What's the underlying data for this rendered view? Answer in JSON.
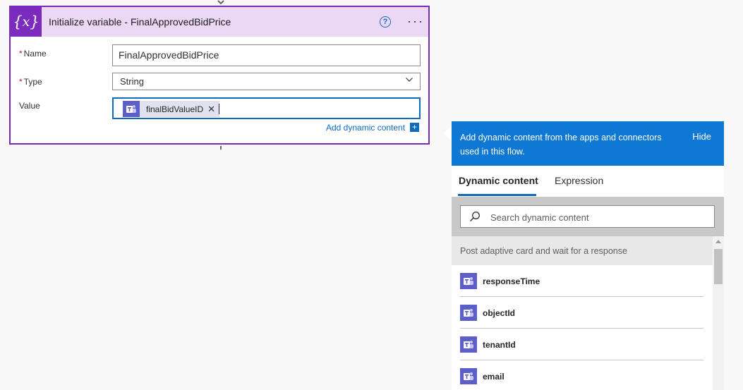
{
  "card": {
    "title": "Initialize variable - FinalApprovedBidPrice",
    "icon": "variable-icon",
    "fields": {
      "name_label": "Name",
      "name_value": "FinalApprovedBidPrice",
      "type_label": "Type",
      "type_value": "String",
      "value_label": "Value",
      "value_token": "finalBidValueID",
      "required_mark": "*"
    },
    "add_dynamic_label": "Add dynamic content",
    "plus": "+",
    "help_glyph": "?",
    "more_glyph": "···"
  },
  "panel": {
    "header_text": "Add dynamic content from the apps and connectors used in this flow.",
    "hide_label": "Hide",
    "tabs": [
      {
        "label": "Dynamic content",
        "active": true
      },
      {
        "label": "Expression",
        "active": false
      }
    ],
    "search": {
      "placeholder": "Search dynamic content"
    },
    "section_title": "Post adaptive card and wait for a response",
    "items": [
      {
        "label": "responseTime"
      },
      {
        "label": "objectId"
      },
      {
        "label": "tenantId"
      },
      {
        "label": "email"
      }
    ]
  },
  "colors": {
    "accent_purple": "#7b2bbd",
    "header_purple": "#ead8f5",
    "panel_blue": "#0f78d4",
    "link_blue": "#0f6cbd",
    "teams_purple": "#5b5fc7"
  }
}
